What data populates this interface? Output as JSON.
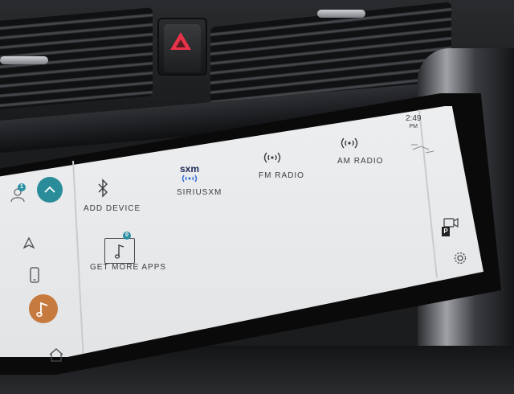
{
  "status": {
    "time": "2:49",
    "ampm": "PM"
  },
  "sidebar": {
    "profile_badge": "1"
  },
  "apps": [
    {
      "label": "ADD DEVICE",
      "icon": "bluetooth-icon"
    },
    {
      "label": "SIRIUSXM",
      "icon": "siriusxm-logo",
      "logo_text": "sxm"
    },
    {
      "label": "FM RADIO",
      "icon": "radio-wave-icon"
    },
    {
      "label": "AM RADIO",
      "icon": "radio-wave-icon"
    },
    {
      "label": "GET MORE APPS",
      "icon": "music-note-icon",
      "badge": "0"
    }
  ],
  "right_bar": {
    "park_label": "P"
  },
  "colors": {
    "screen_bg": "#e8eaec",
    "accent_teal": "#2b8c99",
    "accent_orange": "#c77a3e",
    "hazard_red": "#e8334a"
  }
}
